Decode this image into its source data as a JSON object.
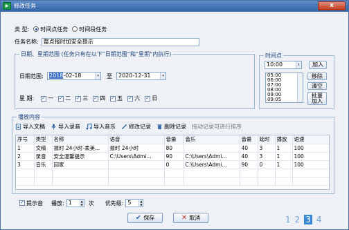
{
  "window": {
    "title": "修改任务",
    "close_label": "x"
  },
  "type_row": {
    "label": "类    型:",
    "options": [
      {
        "label": "时间点任务",
        "selected": true
      },
      {
        "label": "时间段任务",
        "selected": false
      }
    ]
  },
  "task_name": {
    "label": "任务名称:",
    "value": "整点报时加安全提示"
  },
  "date_group": {
    "title": "日期、星期范围 (任务只有在以下“日期范围”和“星期”内执行)",
    "range_label": "日期范围:",
    "start_date_prefix": "2018",
    "start_date_suffix": "-02-18",
    "to_label": "至",
    "end_date": "2020-12-31",
    "week_label": "星    期:",
    "weekdays": [
      {
        "label": "一",
        "checked": true
      },
      {
        "label": "二",
        "checked": true
      },
      {
        "label": "三",
        "checked": true
      },
      {
        "label": "四",
        "checked": true
      },
      {
        "label": "五",
        "checked": true
      },
      {
        "label": "六",
        "checked": true
      },
      {
        "label": "日",
        "checked": true
      }
    ]
  },
  "time_group": {
    "title": "时间点",
    "time_value": "10:00",
    "add_label": "加入",
    "remove_label": "移除",
    "clear_label": "清空",
    "batch_label_1": "批量",
    "batch_label_2": "加入",
    "times": [
      "05:00",
      "06:00",
      "07:00",
      "08:00",
      "09:00",
      "09:05"
    ]
  },
  "play_group": {
    "title": "播放内容",
    "toolbar": {
      "import_doc": "导入文稿",
      "import_record": "导入录音",
      "import_music": "导入音乐",
      "edit_record": "修改记录",
      "delete_record": "删除记录",
      "hint": "拖动记录可进行排序"
    },
    "columns": [
      "序号",
      "类型",
      "名称",
      "语音",
      "音量",
      "音乐",
      "音量",
      "延时",
      "播放",
      "语速"
    ],
    "rows": [
      [
        "1",
        "文稿",
        "报时 24小时-柔美...",
        "报时 24小时",
        "80",
        "",
        "40",
        "3",
        "1",
        "100"
      ],
      [
        "2",
        "录音",
        "安全温馨提示",
        "C:\\Users\\Admi...",
        "90",
        "C:\\Users\\Admi...",
        "40",
        "3",
        "1",
        "100"
      ],
      [
        "3",
        "音乐",
        "回家",
        "",
        "0",
        "C:\\Users\\Admi...",
        "90",
        "0",
        "1",
        "100"
      ]
    ]
  },
  "bottom": {
    "prompt_label": "提示音",
    "prompt_checked": true,
    "play_label": "播放:",
    "play_count": "1",
    "times_label": "次",
    "priority_label": "优先级:",
    "priority_value": "5",
    "save_label": "保存",
    "cancel_label": "取消"
  },
  "pager": {
    "pages": [
      "1",
      "2",
      "3",
      "4"
    ],
    "current": "3"
  }
}
